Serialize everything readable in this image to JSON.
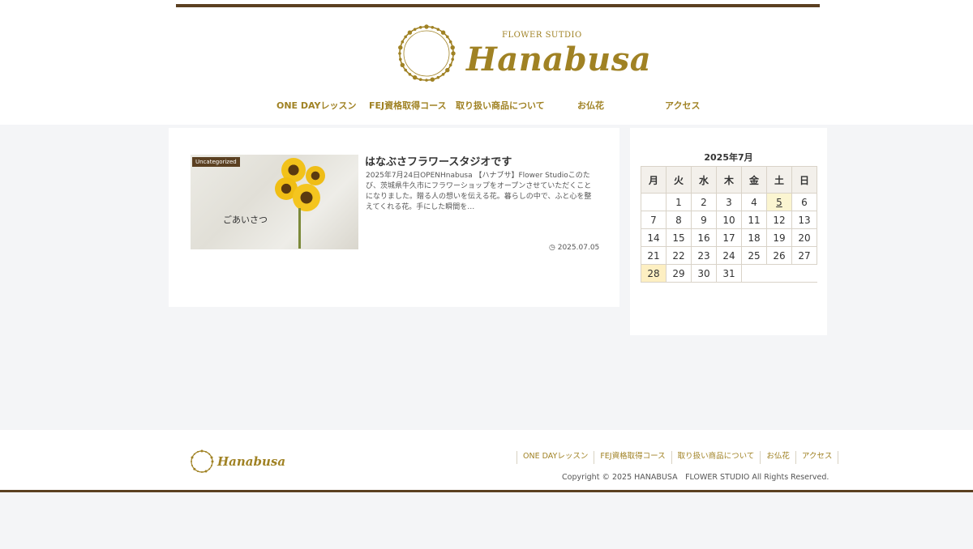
{
  "header": {
    "logo_sub": "FLOWER SUTDIO",
    "logo_name": "Hanabusa",
    "nav": [
      {
        "label": "ONE DAYレッスン"
      },
      {
        "label": "FEJ資格取得コース"
      },
      {
        "label": "取り扱い商品について"
      },
      {
        "label": "お仏花"
      },
      {
        "label": "アクセス"
      }
    ]
  },
  "post": {
    "category": "Uncategorized",
    "thumb_text": "ごあいさつ",
    "title": "はなぶさフラワースタジオです",
    "excerpt": "2025年7月24日OPENHnabusa 【ハナブサ】Flower Studioこのたび、茨城県牛久市にフラワーショップをオープンさせていただくことになりました。贈る人の想いを伝える花。暮らしの中で、ふと心を整えてくれる花。手にした瞬間を…",
    "date": "2025.07.05"
  },
  "calendar": {
    "caption": "2025年7月",
    "weekdays": [
      "月",
      "火",
      "水",
      "木",
      "金",
      "土",
      "日"
    ],
    "weeks": [
      [
        "",
        "1",
        "2",
        "3",
        "4",
        "5",
        "6"
      ],
      [
        "7",
        "8",
        "9",
        "10",
        "11",
        "12",
        "13"
      ],
      [
        "14",
        "15",
        "16",
        "17",
        "18",
        "19",
        "20"
      ],
      [
        "21",
        "22",
        "23",
        "24",
        "25",
        "26",
        "27"
      ],
      [
        "28",
        "29",
        "30",
        "31",
        "",
        "",
        ""
      ]
    ],
    "linked_day": "5",
    "today": "28"
  },
  "footer": {
    "logo_name": "Hanabusa",
    "nav": [
      {
        "label": "ONE DAYレッスン"
      },
      {
        "label": "FEJ資格取得コース"
      },
      {
        "label": "取り扱い商品について"
      },
      {
        "label": "お仏花"
      },
      {
        "label": "アクセス"
      }
    ],
    "copyright": "Copyright © 2025 HANABUSA　FLOWER STUDIO All Rights Reserved."
  },
  "colors": {
    "accent": "#a08224",
    "bar": "#5b4021",
    "page_bg": "#f4f5f7"
  }
}
